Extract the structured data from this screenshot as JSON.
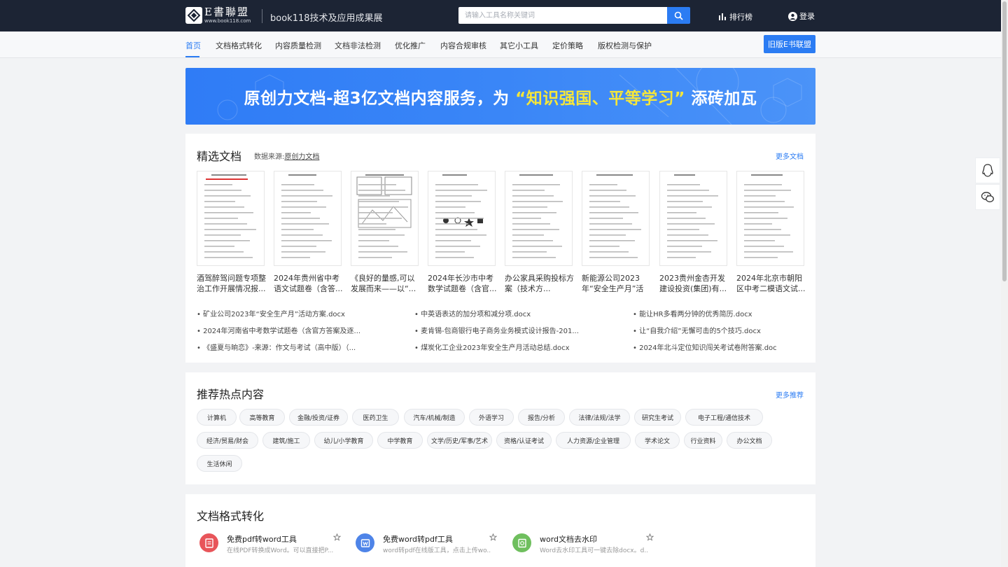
{
  "header": {
    "logo_main": "E書聯盟",
    "logo_url": "www.book118.com",
    "subtitle": "book118技术及应用成果展",
    "search_placeholder": "请输入工具名称关键词",
    "rank_label": "排行榜",
    "login_label": "登录"
  },
  "nav": {
    "items": [
      "首页",
      "文档格式转化",
      "内容质量检测",
      "文档非法检测",
      "优化推广",
      "内容合规审核",
      "其它小工具",
      "定价策略",
      "版权检测与保护"
    ],
    "active_index": 0,
    "old_button": "旧版E书联盟"
  },
  "banner": {
    "text_before": "原创力文档-超3亿文档内容服务，为",
    "text_highlight": "“知识强国、平等学习”",
    "text_after": "添砖加瓦"
  },
  "featured": {
    "title": "精选文档",
    "source_label": "数据来源:",
    "source_link": "原创力文档",
    "more": "更多文档",
    "docs": [
      "酒驾醉驾问题专项整治工作开展情况报...",
      "2024年贵州省中考语文试题卷（含答...",
      "《良好的量感,可以发展而来——以“...",
      "2024年长沙市中考数学试题卷（含官...",
      "办公家具采购投标方案（技术方...",
      "新能源公司2023年“安全生产月”活动...",
      "2023贵州金杏开发建设投资(集团)有...",
      "2024年北京市朝阳区中考二模语文试..."
    ],
    "links": [
      "• 矿业公司2023年“安全生产月”活动方案.docx",
      "• 中英语表达的加分项和减分项.docx",
      "• 能让HR多看两分钟的优秀简历.docx",
      "• 2024年河南省中考数学试题卷（含官方答案及逐...",
      "• 麦肯锡-包商银行电子商务业务模式设计报告-201...",
      "• 让“自我介绍”无懈可击的5个技巧.docx",
      "• 《盛夏与晌恋》-来源：作文与考试（高中版）（...",
      "• 煤炭化工企业2023年安全生产月活动总结.docx",
      "• 2024年北斗定位知识闯关考试卷附答案.doc"
    ]
  },
  "hot": {
    "title": "推荐热点内容",
    "more": "更多推荐",
    "tags": [
      "计算机",
      "高等教育",
      "金融/投资/证券",
      "医药卫生",
      "汽车/机械/制造",
      "外语学习",
      "报告/分析",
      "法律/法规/法学",
      "研究生考试",
      "电子工程/通信技术",
      "经济/贸易/财会",
      "建筑/施工",
      "幼儿/小学教育",
      "中学教育",
      "文学/历史/军事/艺术",
      "资格/认证考试",
      "人力资源/企业管理",
      "学术论文",
      "行业资料",
      "办公文档",
      "生活休闲"
    ]
  },
  "convert": {
    "title": "文档格式转化",
    "tools": [
      {
        "name": "免费pdf转word工具",
        "desc": "在线PDF转换成Word。可以直接把P...",
        "icon": "pdf-icon",
        "color": "#e8555a"
      },
      {
        "name": "免费word转pdf工具",
        "desc": "word转pdf在线版工具，点击上传wo...",
        "icon": "word-icon",
        "color": "#4e84e8"
      },
      {
        "name": "word文档去水印",
        "desc": "Word去水印工具可一键去除docx。d...",
        "icon": "watermark-icon",
        "color": "#6fbf5e"
      }
    ]
  },
  "colors": {
    "accent": "#2b7cf3",
    "topbar": "#1c2434",
    "banner_highlight": "#f5e63a"
  }
}
